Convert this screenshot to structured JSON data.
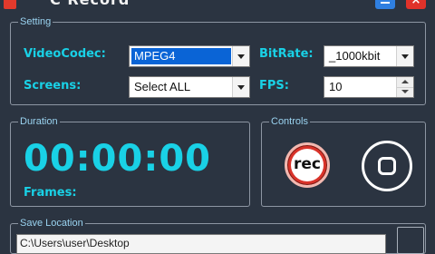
{
  "window": {
    "title": "C Record",
    "minimize_label": "",
    "close_label": "×"
  },
  "setting": {
    "legend": "Setting",
    "video_codec": {
      "label": "VideoCodec:",
      "value": "MPEG4"
    },
    "bitrate": {
      "label": "BitRate:",
      "value": "_1000kbit"
    },
    "screens": {
      "label": "Screens:",
      "value": "Select ALL"
    },
    "fps": {
      "label": "FPS:",
      "value": "10"
    }
  },
  "duration": {
    "legend": "Duration",
    "time": "00:00:00",
    "frames_label": "Frames:"
  },
  "controls": {
    "legend": "Controls",
    "rec_label": "rec"
  },
  "save_location": {
    "legend": "Save Location",
    "path": "C:\\Users\\user\\Desktop"
  },
  "colors": {
    "background": "#2b3441",
    "accent_cyan": "#19d1e6",
    "legend_blue": "#9ad3f0",
    "record_red": "#d9332a",
    "selection_blue": "#0a64d6"
  }
}
